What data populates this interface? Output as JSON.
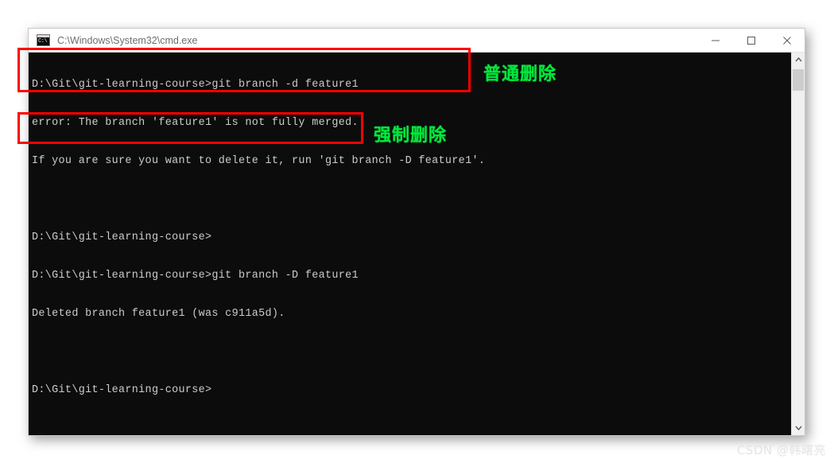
{
  "window": {
    "title": "C:\\Windows\\System32\\cmd.exe",
    "icon_name": "cmd-icon",
    "icon_prompt": "C:\\",
    "controls": {
      "minimize_label": "Minimize",
      "maximize_label": "Maximize",
      "close_label": "Close"
    }
  },
  "terminal": {
    "lines": [
      "D:\\Git\\git-learning-course>git branch -d feature1",
      "error: The branch 'feature1' is not fully merged.",
      "If you are sure you want to delete it, run 'git branch -D feature1'.",
      "",
      "D:\\Git\\git-learning-course>",
      "D:\\Git\\git-learning-course>git branch -D feature1",
      "Deleted branch feature1 (was c911a5d).",
      "",
      "D:\\Git\\git-learning-course>"
    ],
    "foreground_color": "#cccccc",
    "background_color": "#0c0c0c"
  },
  "scrollbar": {
    "up_arrow": "⌃",
    "down_arrow": "⌄"
  },
  "annotations": {
    "highlight_color": "#ff0000",
    "label_color": "#00e83c",
    "normal_delete": "普通删除",
    "force_delete": "强制删除"
  },
  "watermark": {
    "text": "CSDN @韩曙亮"
  }
}
